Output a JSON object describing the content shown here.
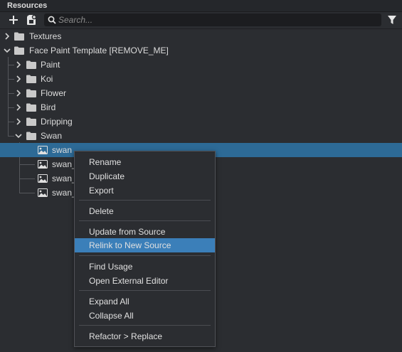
{
  "panel": {
    "title": "Resources"
  },
  "toolbar": {
    "search_placeholder": "Search..."
  },
  "tree": [
    {
      "label": "Textures",
      "type": "folder",
      "expanded": false
    },
    {
      "label": "Face Paint Template [REMOVE_ME]",
      "type": "folder",
      "expanded": true
    },
    {
      "label": "Paint",
      "type": "folder",
      "expanded": false
    },
    {
      "label": "Koi",
      "type": "folder",
      "expanded": false
    },
    {
      "label": "Flower",
      "type": "folder",
      "expanded": false
    },
    {
      "label": "Bird",
      "type": "folder",
      "expanded": false
    },
    {
      "label": "Dripping",
      "type": "folder",
      "expanded": false
    },
    {
      "label": "Swan",
      "type": "folder",
      "expanded": true
    },
    {
      "label": "swan",
      "type": "image",
      "selected": true
    },
    {
      "label": "swan_",
      "type": "image"
    },
    {
      "label": "swan_",
      "type": "image"
    },
    {
      "label": "swan_",
      "type": "image"
    }
  ],
  "context_menu": {
    "items": [
      "Rename",
      "Duplicate",
      "Export",
      "Delete",
      "Update from Source",
      "Relink to New Source",
      "Find Usage",
      "Open External Editor",
      "Expand All",
      "Collapse All",
      "Refactor > Replace"
    ],
    "highlighted": "Relink to New Source"
  },
  "colors": {
    "background": "#2b2d31",
    "selection": "#2d6a96",
    "menu_highlight": "#3b7fb9"
  }
}
